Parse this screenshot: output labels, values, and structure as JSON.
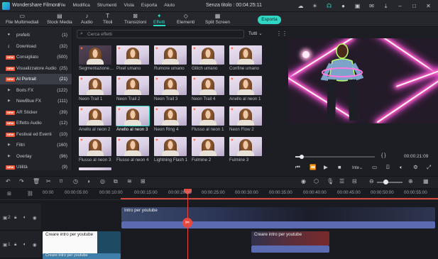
{
  "app": {
    "name": "Wondershare Filmora",
    "menus": [
      "File",
      "Modifica",
      "Strumenti",
      "Vista",
      "Esporta",
      "Aiuto"
    ],
    "doc_title": "Senza titolo : 00:04:25:11"
  },
  "toolbar": {
    "tabs": [
      "File Multimediali",
      "Stock Media",
      "Audio",
      "Titoli",
      "Transizioni",
      "Effetti",
      "Elementi",
      "Split Screen"
    ],
    "active_tab": "Effetti",
    "export_label": "Esporta"
  },
  "sidebar": {
    "items": [
      {
        "label": "prefeiti",
        "count": "(1)",
        "badge": "",
        "expand": false,
        "icon": "heart"
      },
      {
        "label": "Download",
        "count": "(32)",
        "badge": "",
        "expand": false,
        "icon": "download"
      },
      {
        "label": "Consigliato",
        "count": "(500)",
        "badge": "NEW",
        "expand": false,
        "icon": ""
      },
      {
        "label": "Visualizzatore Audio",
        "count": "(25)",
        "badge": "NEW",
        "expand": false,
        "icon": ""
      },
      {
        "label": "AI Portrait",
        "count": "(21)",
        "badge": "NEW",
        "expand": false,
        "icon": "",
        "active": true
      },
      {
        "label": "Boris FX",
        "count": "(122)",
        "badge": "",
        "expand": true,
        "icon": ""
      },
      {
        "label": "NewBlue FX",
        "count": "(111)",
        "badge": "",
        "expand": true,
        "icon": ""
      },
      {
        "label": "AR Sticker",
        "count": "(39)",
        "badge": "NEW",
        "expand": false,
        "icon": ""
      },
      {
        "label": "Effetto Audio",
        "count": "(12)",
        "badge": "NEW",
        "expand": false,
        "icon": ""
      },
      {
        "label": "Festival ed Eventi",
        "count": "(10)",
        "badge": "NEW",
        "expand": false,
        "icon": ""
      },
      {
        "label": "Filtri",
        "count": "(160)",
        "badge": "",
        "expand": true,
        "icon": ""
      },
      {
        "label": "Overlay",
        "count": "(96)",
        "badge": "",
        "expand": true,
        "icon": ""
      },
      {
        "label": "Utilità",
        "count": "(9)",
        "badge": "NEW",
        "expand": false,
        "icon": ""
      }
    ]
  },
  "search": {
    "placeholder": "Cerca effetti",
    "filter": "Tutti"
  },
  "effects": [
    [
      "Segmentazione…",
      "Pixel umano",
      "Rumore umano",
      "Glitch umano",
      "Confine umano"
    ],
    [
      "Neon Trail 1",
      "Neon Trail 2",
      "Neon Trail 3",
      "Neon Trail 4",
      "Anello al neon 1"
    ],
    [
      "Anello al neon 2",
      "Anello al neon 3",
      "Neon Ring 4",
      "Flusso al neon 1",
      "Neon Flow 2"
    ],
    [
      "Flusso al neon 3",
      "Flusso al neon 4",
      "Lightning Flash 1",
      "Fulmine 2",
      "Fulmine 3"
    ]
  ],
  "selected_effect": "Anello al neon 3",
  "player": {
    "time": "00:00:21:09",
    "quality": "Inte",
    "progress": 0.08,
    "markers": "{    }"
  },
  "timeline": {
    "ruler": [
      "00:00",
      "00:00:05:00",
      "00:00:10:00",
      "00:00:15:00",
      "00:00:20:00",
      "00:00:25:00",
      "00:00:30:00",
      "00:00:35:00",
      "00:00:40:00",
      "00:00:45:00",
      "00:00:50:00",
      "00:00:55:00"
    ],
    "tracks": [
      {
        "label": "2",
        "clip_title": "Intro per youtube"
      },
      {
        "label": "1",
        "clip_title": "Creare intro per youtube"
      }
    ],
    "clip2_title": "Creare intro per youtube",
    "clip3_title": "Creare intro per youtube",
    "playhead_time": "00:00:20:00"
  },
  "colors": {
    "accent": "#2fd6c3",
    "playhead": "#e7483e",
    "badge": "#f05a3a"
  }
}
